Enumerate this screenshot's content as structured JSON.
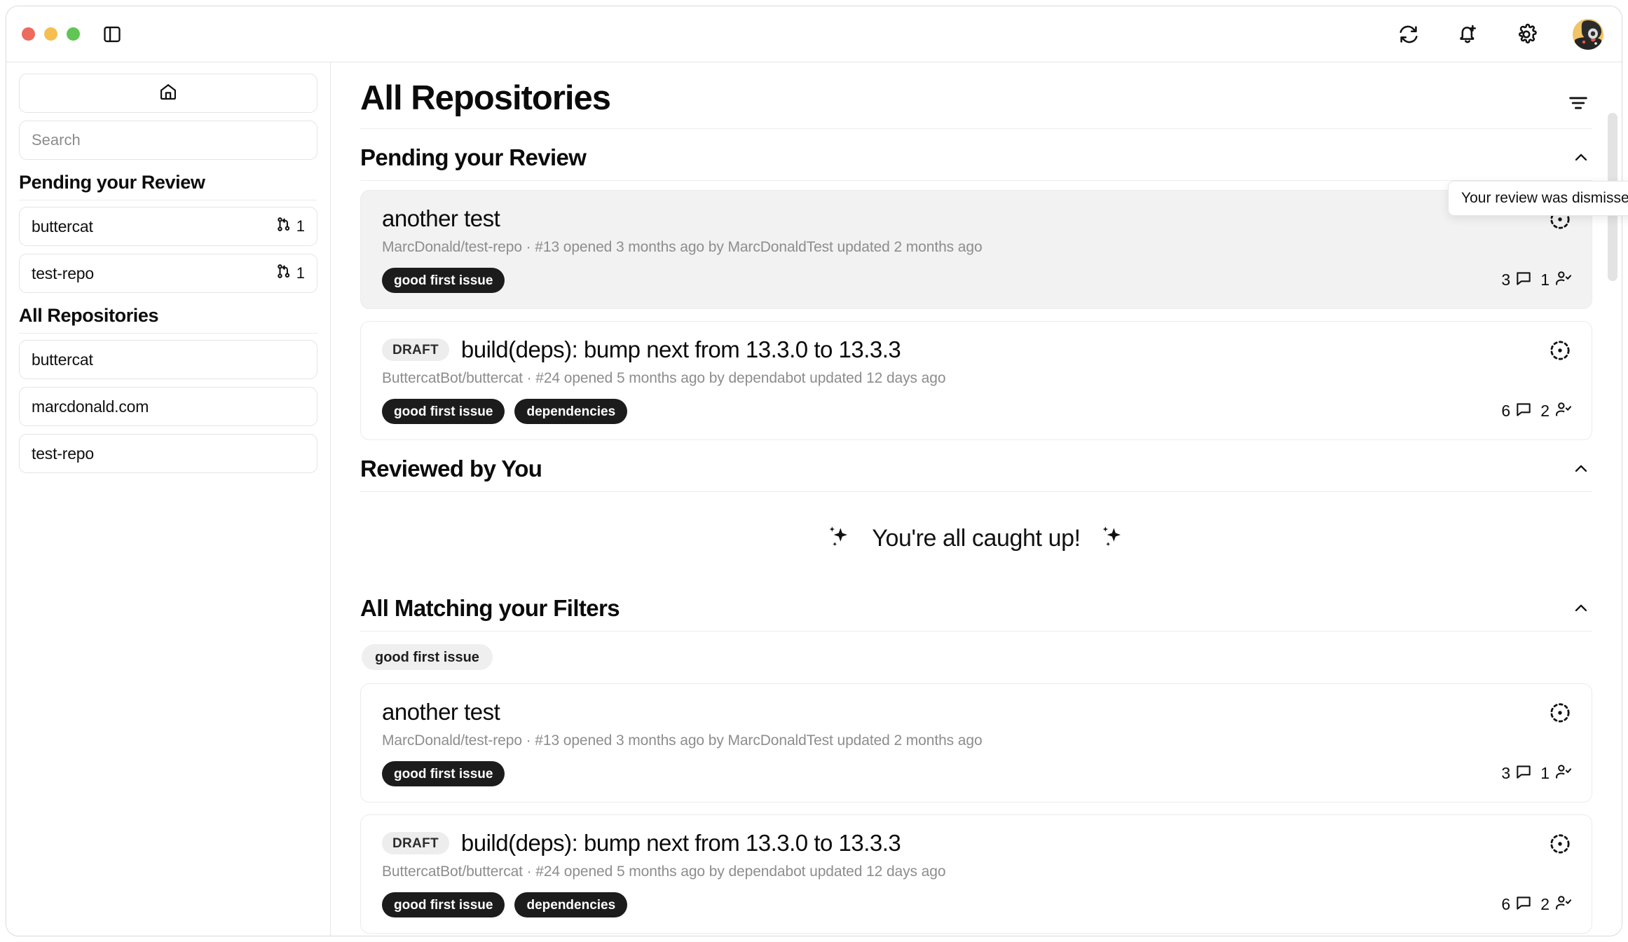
{
  "titlebar": {
    "traffic_lights": [
      "close",
      "minimize",
      "maximize"
    ],
    "sidebar_toggle_name": "sidebar-toggle-icon",
    "actions": [
      {
        "name": "refresh-icon",
        "label": "Refresh"
      },
      {
        "name": "bell-plus-icon",
        "label": "Notifications"
      },
      {
        "name": "gear-icon",
        "label": "Settings"
      }
    ],
    "avatar_name": "user-avatar"
  },
  "sidebar": {
    "home_button_label": "Home",
    "search": {
      "value": "",
      "placeholder": "Search"
    },
    "sections": [
      {
        "heading": "Pending your Review",
        "items": [
          {
            "label": "buttercat",
            "count": "1",
            "icon": "pull-request-icon"
          },
          {
            "label": "test-repo",
            "count": "1",
            "icon": "pull-request-icon"
          }
        ]
      },
      {
        "heading": "All Repositories",
        "items": [
          {
            "label": "buttercat",
            "count": "",
            "icon": ""
          },
          {
            "label": "marcdonald.com",
            "count": "",
            "icon": ""
          },
          {
            "label": "test-repo",
            "count": "",
            "icon": ""
          }
        ]
      }
    ]
  },
  "main": {
    "page_title": "All Repositories",
    "filter_button_label": "Filter",
    "tooltip": "Your review was dismissed",
    "sections": [
      {
        "title": "Pending your Review",
        "collapse_icon": "chevron-up-icon",
        "cards": [
          {
            "draft": "",
            "title": "another test",
            "subtitle": "MarcDonald/test-repo · #13 opened 3 months ago by MarcDonaldTest updated 2 months ago",
            "labels": [
              "good first issue"
            ],
            "comments": "3",
            "reviewers": "1",
            "status_icon": "pr-open-dashed-icon",
            "hovered": true
          },
          {
            "draft": "DRAFT",
            "title": "build(deps): bump next from 13.3.0 to 13.3.3",
            "subtitle": "ButtercatBot/buttercat · #24 opened 5 months ago by dependabot updated 12 days ago",
            "labels": [
              "good first issue",
              "dependencies"
            ],
            "comments": "6",
            "reviewers": "2",
            "status_icon": "pr-open-dashed-icon",
            "hovered": false
          }
        ]
      },
      {
        "title": "Reviewed by You",
        "collapse_icon": "chevron-up-icon",
        "empty_text": "You're all caught up!",
        "cards": []
      },
      {
        "title": "All Matching your Filters",
        "collapse_icon": "chevron-up-icon",
        "chips": [
          "good first issue"
        ],
        "cards": [
          {
            "draft": "",
            "title": "another test",
            "subtitle": "MarcDonald/test-repo · #13 opened 3 months ago by MarcDonaldTest updated 2 months ago",
            "labels": [
              "good first issue"
            ],
            "comments": "3",
            "reviewers": "1",
            "status_icon": "pr-open-dashed-icon",
            "hovered": false
          },
          {
            "draft": "DRAFT",
            "title": "build(deps): bump next from 13.3.0 to 13.3.3",
            "subtitle": "ButtercatBot/buttercat · #24 opened 5 months ago by dependabot updated 12 days ago",
            "labels": [
              "good first issue",
              "dependencies"
            ],
            "comments": "6",
            "reviewers": "2",
            "status_icon": "pr-open-dashed-icon",
            "hovered": false
          }
        ]
      }
    ]
  },
  "colors": {
    "label_pill_bg": "#1c1c1c",
    "draft_badge_bg": "#ededed",
    "card_hover_bg": "#f2f2f2",
    "traffic_red": "#ed6a5e",
    "traffic_yellow": "#f4bf50",
    "traffic_green": "#61c554"
  }
}
